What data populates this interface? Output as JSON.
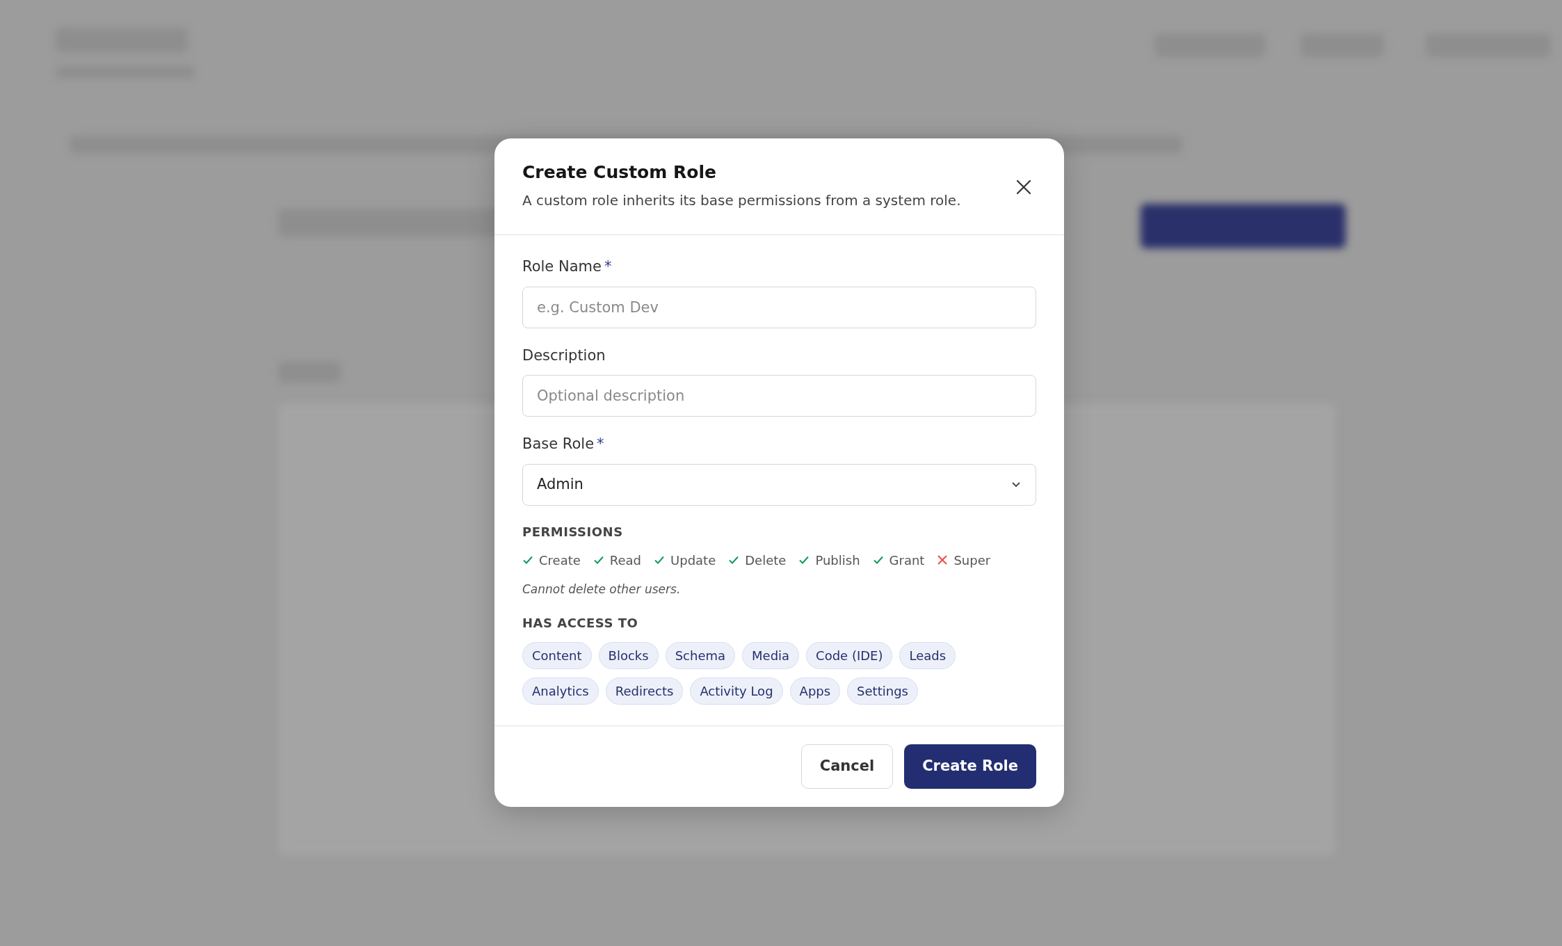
{
  "dialog": {
    "title": "Create Custom Role",
    "subtitle": "A custom role inherits its base permissions from a system role.",
    "fields": [
      {
        "kind": "text",
        "label": "Role Name",
        "required_mark": "*",
        "placeholder": "e.g. Custom Dev"
      },
      {
        "kind": "text",
        "label": "Description",
        "placeholder": "Optional description"
      },
      {
        "kind": "select",
        "label": "Base Role",
        "required_mark": "*",
        "value": "Admin"
      }
    ],
    "permissions_heading": "PERMISSIONS",
    "permissions": [
      {
        "label": "Create",
        "granted": true
      },
      {
        "label": "Read",
        "granted": true
      },
      {
        "label": "Update",
        "granted": true
      },
      {
        "label": "Delete",
        "granted": true
      },
      {
        "label": "Publish",
        "granted": true
      },
      {
        "label": "Grant",
        "granted": true
      },
      {
        "label": "Super",
        "granted": false
      }
    ],
    "note": "Cannot delete other users.",
    "access_heading": "HAS ACCESS TO",
    "access": [
      "Content",
      "Blocks",
      "Schema",
      "Media",
      "Code (IDE)",
      "Leads",
      "Analytics",
      "Redirects",
      "Activity Log",
      "Apps",
      "Settings"
    ],
    "buttons": [
      {
        "kind": "secondary",
        "label": "Cancel"
      },
      {
        "kind": "primary",
        "label": "Create Role"
      }
    ]
  }
}
